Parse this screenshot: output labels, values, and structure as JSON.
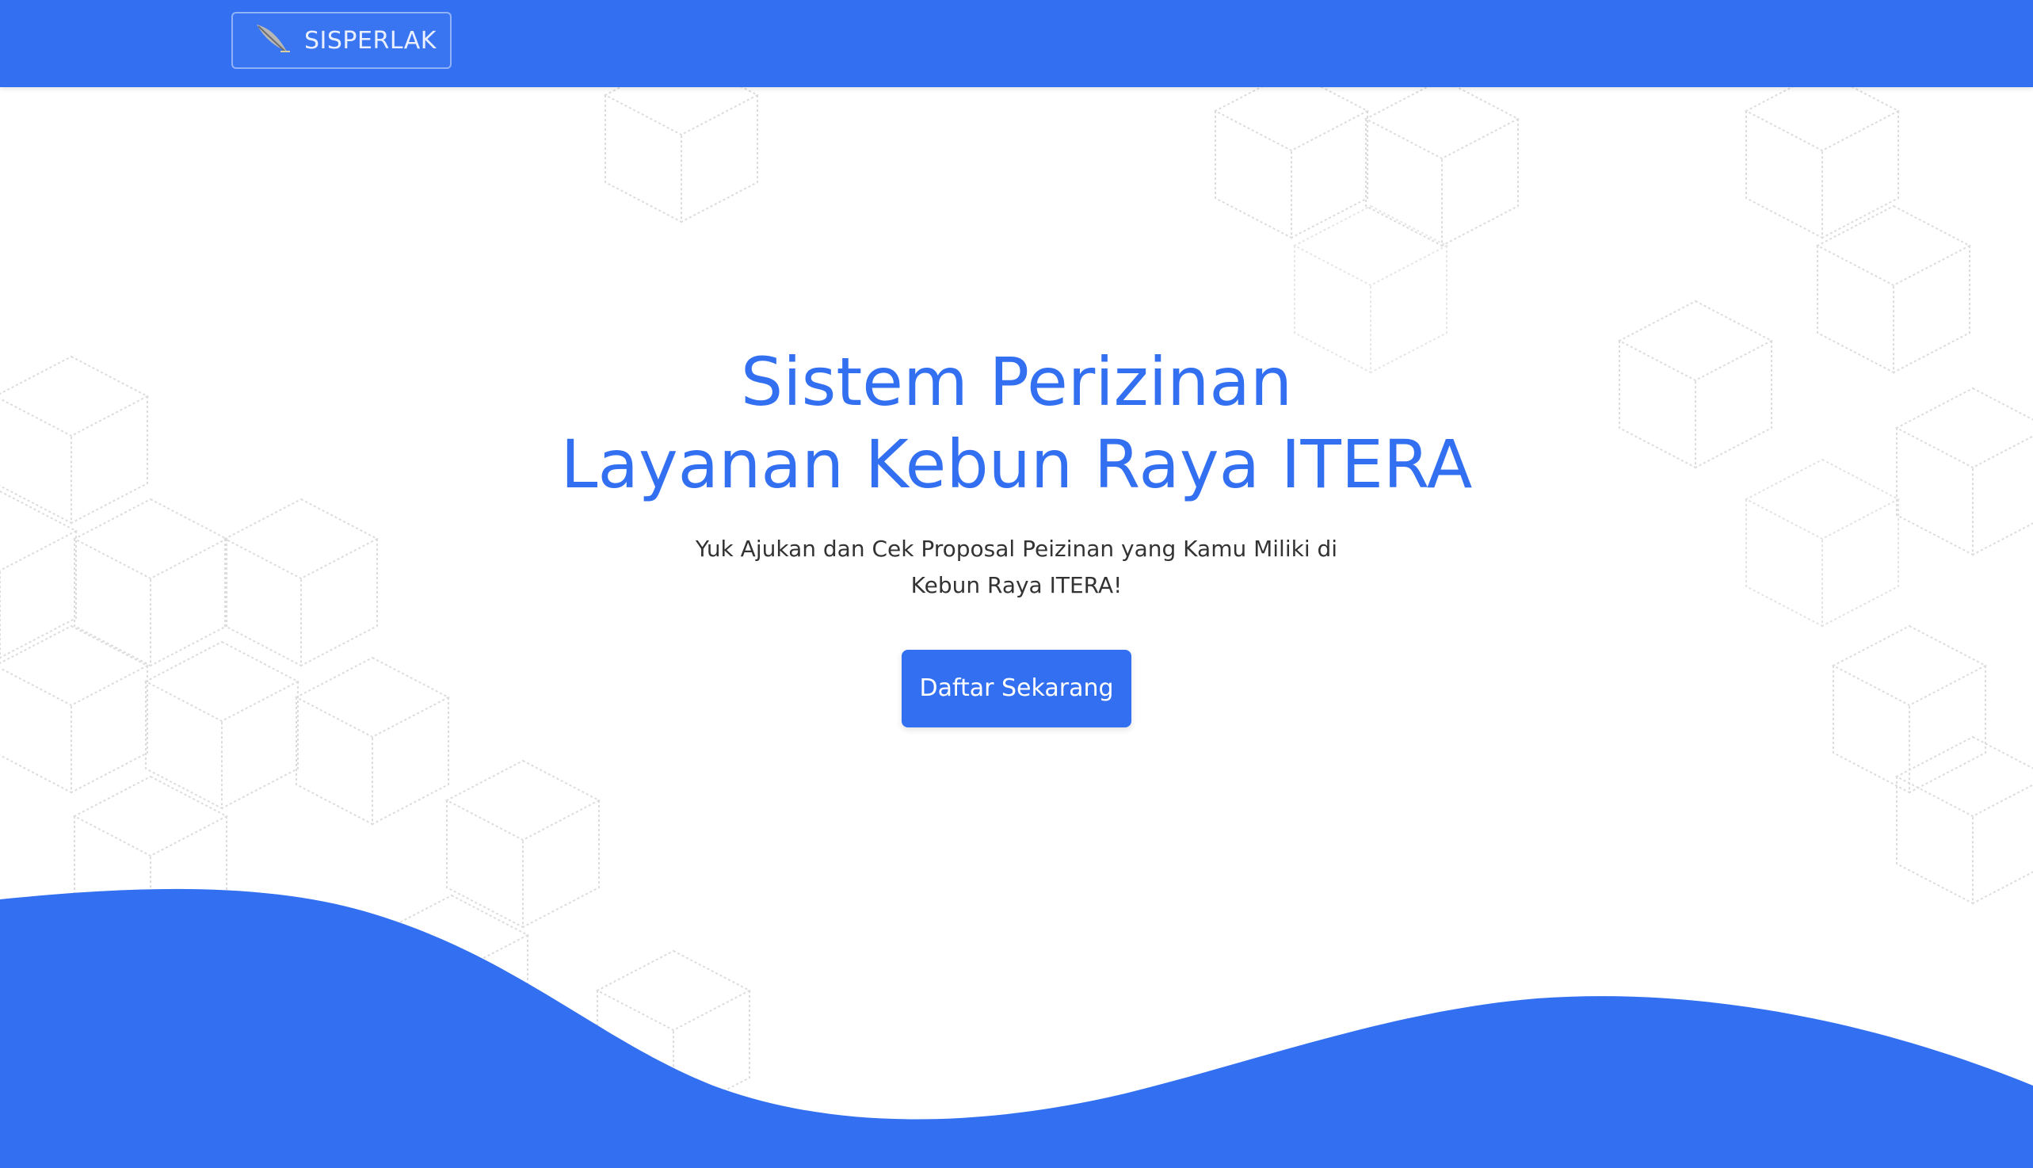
{
  "colors": {
    "primary": "#3370f1",
    "background": "#ffffff",
    "text_dark": "#333333",
    "pattern_line": "#e1e1e1"
  },
  "navbar": {
    "brand_text": "SISPERLAK",
    "brand_icon": "leaf-logo-icon"
  },
  "hero": {
    "title_line1": "Sistem Perizinan",
    "title_line2": "Layanan Kebun Raya ITERA",
    "subtitle": "Yuk Ajukan dan Cek Proposal Peizinan yang Kamu Miliki di Kebun Raya ITERA!",
    "cta_label": "Daftar Sekarang"
  }
}
